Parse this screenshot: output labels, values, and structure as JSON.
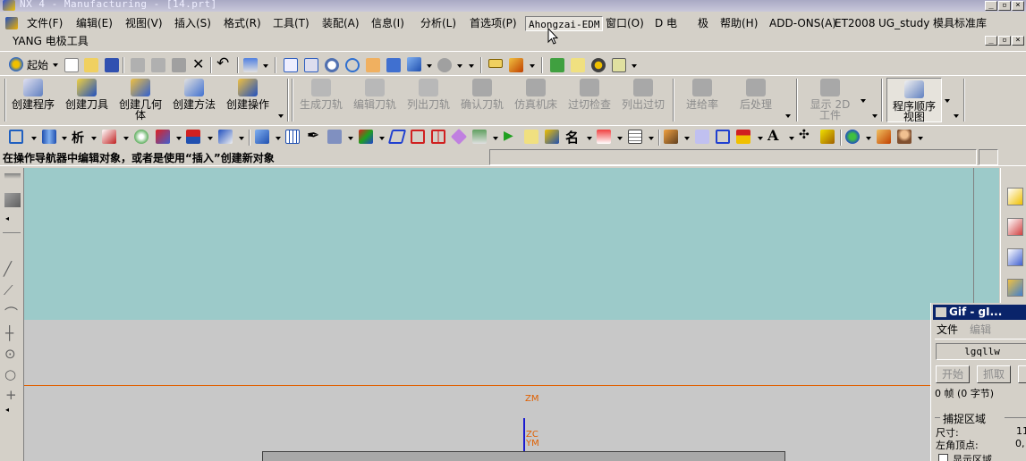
{
  "window": {
    "title": "NX 4 - Manufacturing - [14.prt]"
  },
  "menubar": {
    "items": [
      {
        "label": "文件(F)"
      },
      {
        "label": "编辑(E)"
      },
      {
        "label": "视图(V)"
      },
      {
        "label": "插入(S)"
      },
      {
        "label": "格式(R)"
      },
      {
        "label": "工具(T)"
      },
      {
        "label": "装配(A)"
      },
      {
        "label": "信息(I)"
      },
      {
        "label": "分析(L)"
      },
      {
        "label": "首选项(P)"
      },
      {
        "label": "Ahongzai-EDM"
      },
      {
        "label": "窗口(O)"
      },
      {
        "label": "D 电"
      },
      {
        "label": "极"
      },
      {
        "label": "帮助(H)"
      },
      {
        "label": "ADD-ONS(A)"
      },
      {
        "label": "ET2008"
      },
      {
        "label": "UG_study"
      },
      {
        "label": "模具标准库"
      }
    ],
    "second_row_label": "YANG 电极工具"
  },
  "standard_toolbar": {
    "start_label": "起始"
  },
  "operation_toolbar": {
    "buttons": [
      {
        "label": "创建程序",
        "enabled": true
      },
      {
        "label": "创建刀具",
        "enabled": true
      },
      {
        "label": "创建几何",
        "label2": "体",
        "enabled": true
      },
      {
        "label": "创建方法",
        "enabled": true
      },
      {
        "label": "创建操作",
        "enabled": true
      },
      {
        "label": "生成刀轨",
        "enabled": false
      },
      {
        "label": "编辑刀轨",
        "enabled": false
      },
      {
        "label": "列出刀轨",
        "enabled": false
      },
      {
        "label": "确认刀轨",
        "enabled": false
      },
      {
        "label": "仿真机床",
        "enabled": false
      },
      {
        "label": "过切检查",
        "enabled": false
      },
      {
        "label": "列出过切",
        "enabled": false
      },
      {
        "label": "进给率",
        "enabled": false
      },
      {
        "label": "后处理",
        "enabled": false
      },
      {
        "label": "显示 2D",
        "label2": "工件",
        "enabled": false
      },
      {
        "label": "程序顺序",
        "label2": "视图",
        "enabled": true
      }
    ]
  },
  "status": {
    "cue_line": "在操作导航器中编辑对象，或者是使用“插入”创建新对象"
  },
  "graphics": {
    "zm_label": "ZM",
    "zc_label": "ZC",
    "ym_label": "YM",
    "background_top": "#9ccac9",
    "background_bottom": "#c8c8c8",
    "axis_color": "#e06000",
    "zc_axis_color": "#1a1ad0"
  },
  "gif_panel": {
    "title": "Gif - gI...",
    "menu_file": "文件",
    "menu_edit": "编辑",
    "name_field": "lgqllw",
    "start_button": "开始",
    "capture_button": "抓取",
    "frames_text": "0 帧 (0 字节)",
    "capture_region_label": "捕捉区域",
    "size_label": "尺寸:",
    "size_value": "11",
    "corner_label": "左角顶点:",
    "corner_value": "0,",
    "show_region_label": "显示区域"
  }
}
